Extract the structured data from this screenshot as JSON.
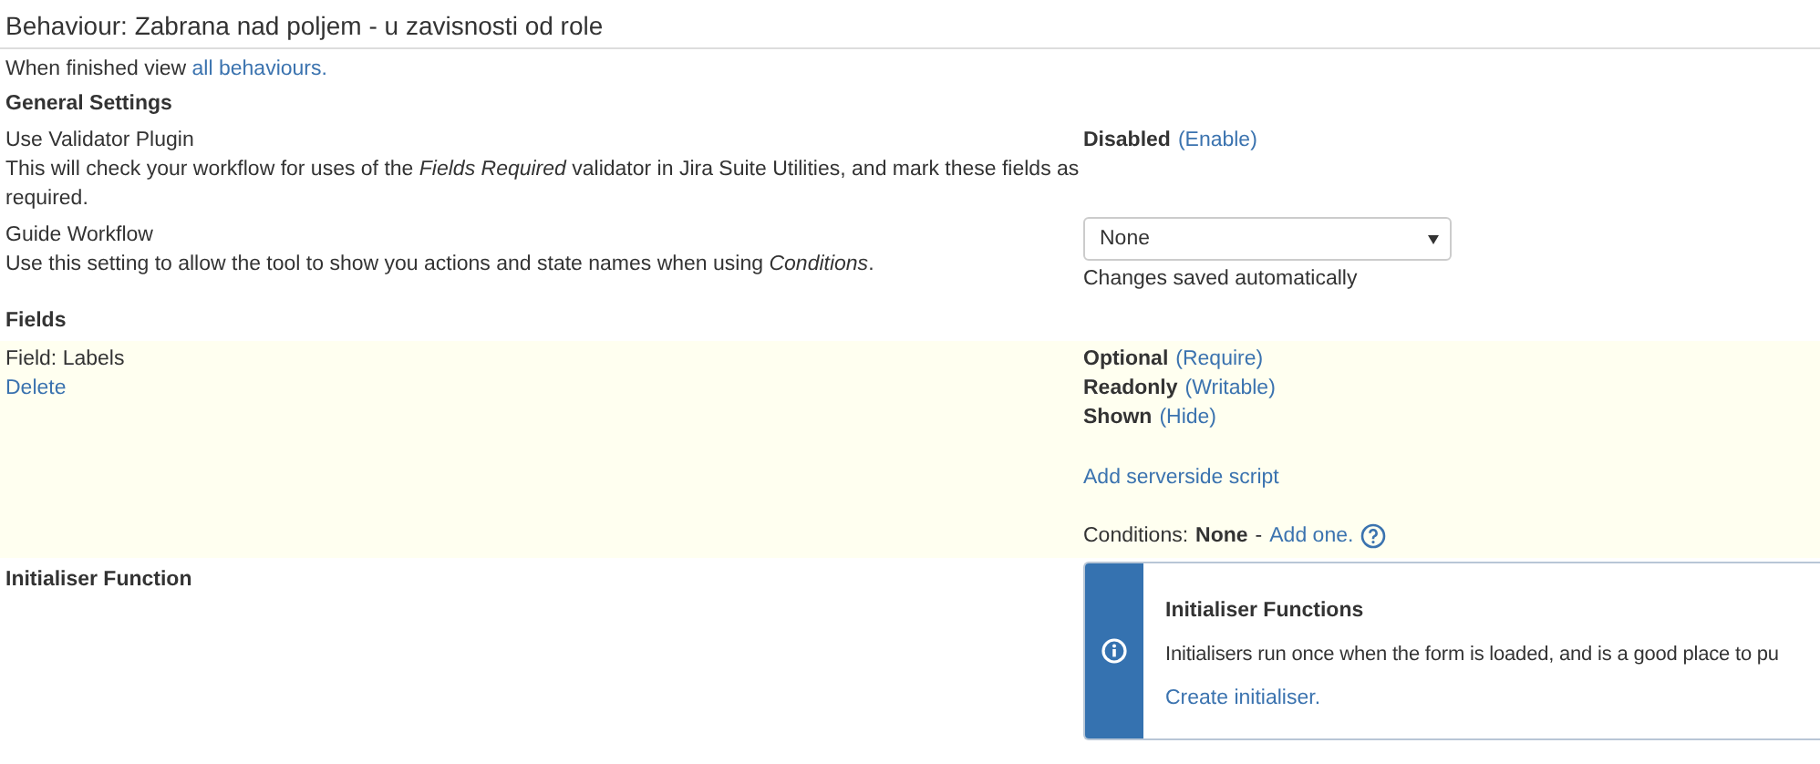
{
  "title": "Behaviour: Zabrana nad poljem - u zavisnosti od role",
  "back_link": {
    "text": "When finished view",
    "link": "all behaviours."
  },
  "general_settings": {
    "heading": "General Settings",
    "validator": {
      "label": "Use Validator Plugin",
      "description": "This will check your workflow for uses of the *Fields Required* validator in Jira Suite Utilities, and mark these fields as required.",
      "value": "Disabled",
      "action": "(Enable)"
    },
    "guide_workflow": {
      "label": "Guide Workflow",
      "description": "Use this setting to allow the tool to show you actions and state names when using *Conditions*.",
      "select_value": "None",
      "note": "Changes saved automatically"
    }
  },
  "fields": {
    "heading": "Fields",
    "items": [
      {
        "name": "Field: Labels",
        "delete": "Delete",
        "flags": [
          {
            "state": "Optional",
            "action": "(Require)"
          },
          {
            "state": "Readonly",
            "action": "(Writable)"
          },
          {
            "state": "Shown",
            "action": "(Hide)"
          }
        ],
        "script_link": "Add serverside script",
        "conditions": {
          "label": "Conditions:",
          "value": "None",
          "separator": "-",
          "action": "Add one."
        }
      }
    ]
  },
  "initialiser": {
    "heading": "Initialiser Function",
    "panel": {
      "title": "Initialiser Functions",
      "message": "Initialisers run once when the form is loaded, and is a good place to pu",
      "link": "Create initialiser."
    }
  }
}
